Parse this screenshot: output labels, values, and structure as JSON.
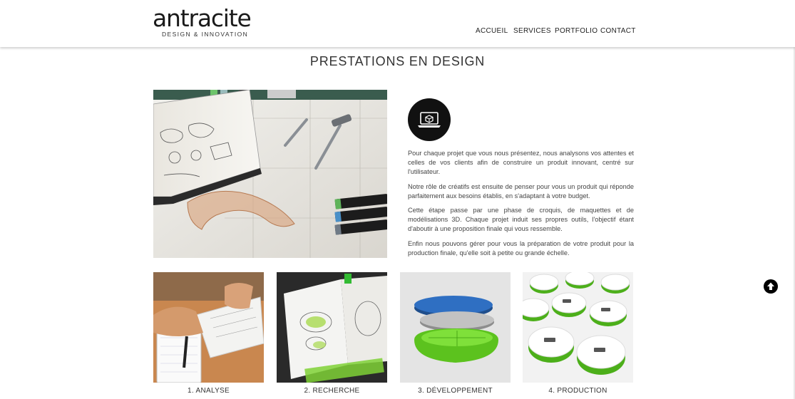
{
  "header": {
    "logo_text": "antracite",
    "logo_tagline": "DESIGN & INNOVATION",
    "nav": [
      {
        "label": "ACCUEIL"
      },
      {
        "label": "SERVICES"
      },
      {
        "label": "PORTFOLIO"
      },
      {
        "label": "CONTACT"
      }
    ]
  },
  "main": {
    "title": "PRESTATIONS EN DESIGN",
    "icon": "laptop-cube-icon",
    "paragraphs": [
      "Pour chaque projet que vous nous présentez, nous analysons vos attentes et celles de vos clients afin de construire un produit innovant, centré sur l'utilisateur.",
      "Notre rôle de créatifs est ensuite de penser pour vous un produit qui réponde parfaitement aux besoins établis, en s'adaptant à votre budget.",
      "Cette étape passe par une phase de croquis, de maquettes et de modélisations 3D. Chaque projet induit ses propres outils, l'objectif étant d'aboutir à une proposition finale qui vous ressemble.",
      "Enfin nous pouvons gérer pour vous la préparation de votre produit pour la production finale, qu'elle soit à petite ou grande échelle."
    ],
    "steps": [
      {
        "label": "1. ANALYSE"
      },
      {
        "label": "2. RECHERCHE"
      },
      {
        "label": "3. DÉVELOPPEMENT"
      },
      {
        "label": "4. PRODUCTION"
      }
    ]
  },
  "colors": {
    "accent_green": "#5fbf2a",
    "dark": "#111111"
  }
}
